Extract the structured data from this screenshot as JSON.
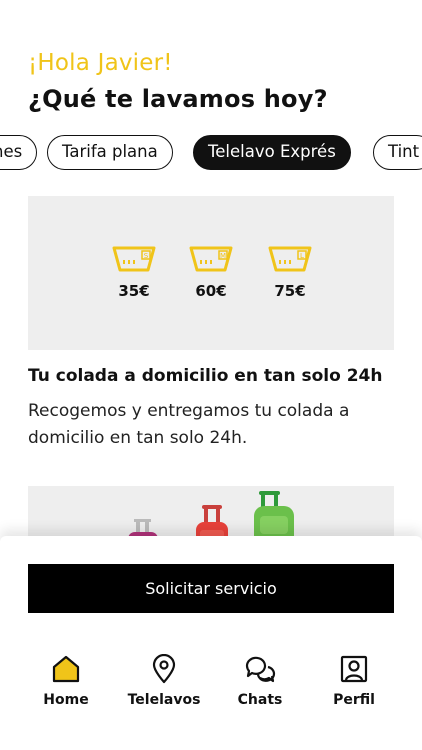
{
  "header": {
    "greeting": "¡Hola Javier!",
    "title": "¿Qué te lavamos hoy?"
  },
  "categories": [
    {
      "label": "nes",
      "active": false
    },
    {
      "label": "Tarifa plana",
      "active": false
    },
    {
      "label": "Telelavo Exprés",
      "active": true
    },
    {
      "label": "Tint",
      "active": false
    }
  ],
  "prices": [
    {
      "size": "S",
      "label": "35€"
    },
    {
      "size": "M",
      "label": "60€"
    },
    {
      "size": "L",
      "label": "75€"
    }
  ],
  "service": {
    "title": "Tu colada a domicilio en tan solo 24h",
    "description": "Recogemos y entregamos tu colada a domicilio en tan solo 24h."
  },
  "cta": {
    "label": "Solicitar servicio"
  },
  "tabs": [
    {
      "label": "Home",
      "icon": "home-icon",
      "active": true
    },
    {
      "label": "Telelavos",
      "icon": "location-pin-icon",
      "active": false
    },
    {
      "label": "Chats",
      "icon": "chat-bubbles-icon",
      "active": false
    },
    {
      "label": "Perfil",
      "icon": "profile-icon",
      "active": false
    }
  ],
  "colors": {
    "accent": "#f0c419",
    "dark": "#111111",
    "card_bg": "#eeeeee"
  }
}
